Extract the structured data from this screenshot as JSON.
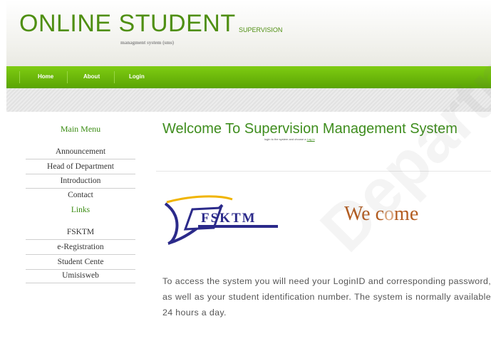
{
  "header": {
    "title": "ONLINE STUDENT",
    "subtitle": "SUPERVISION",
    "tagline": "managment system (sms)"
  },
  "nav": {
    "items": [
      {
        "label": "Home"
      },
      {
        "label": "About"
      },
      {
        "label": "Login"
      }
    ]
  },
  "sidebar": {
    "title": "Main Menu",
    "items": [
      {
        "label": "Announcement"
      },
      {
        "label": "Head of Department"
      },
      {
        "label": "Introduction"
      },
      {
        "label": "Contact"
      }
    ],
    "links_heading": "Links",
    "links": [
      {
        "label": "FSKTM"
      },
      {
        "label": "e-Registration"
      },
      {
        "label": "Student Cente"
      },
      {
        "label": "Umisisweb"
      }
    ]
  },
  "main": {
    "title": "Welcome To Supervision Management System",
    "note_prefix": "login to the system and choose a",
    "note_link": "Log In",
    "logo_text": "FSKTM",
    "welcome_image_text": [
      "We c",
      "o",
      "me"
    ],
    "body": "To access the system you will need your LoginID and corresponding password, as well as your student identification number. The system is normally available 24 hours a day."
  },
  "watermark": {
    "text": "Department"
  },
  "colors": {
    "brand_green": "#4f8f12",
    "nav_green": "#6bb80b",
    "welcome_orange": "#b35c20"
  }
}
